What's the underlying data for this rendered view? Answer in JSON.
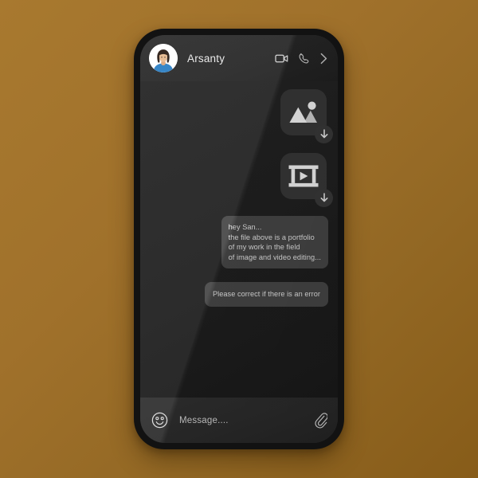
{
  "background": {
    "color_top_left": "#a8792f",
    "color_bottom_right": "#875c19"
  },
  "device": {
    "frame_color": "#121212",
    "screen_color": "#232323"
  },
  "header": {
    "contact_name": "Arsanty",
    "avatar": {
      "icon": "person-avatar",
      "hair_color": "#2b1d15",
      "skin_color": "#e7b98e",
      "shirt_color": "#2c7fc4",
      "background_color": "#ffffff"
    },
    "actions": [
      {
        "name": "video-call",
        "icon": "video-camera-icon"
      },
      {
        "name": "voice-call",
        "icon": "phone-handset-icon"
      },
      {
        "name": "more",
        "icon": "chevron-right-icon"
      }
    ]
  },
  "chat": {
    "attachments": [
      {
        "type": "image",
        "icon": "image-placeholder-icon",
        "download_icon": "download-arrow-icon",
        "tile_color": "#3a3a3a"
      },
      {
        "type": "video",
        "icon": "video-placeholder-icon",
        "download_icon": "download-arrow-icon",
        "tile_color": "#3a3a3a"
      }
    ],
    "messages": [
      {
        "id": "m1",
        "text": "hey San...\nthe file above is a portfolio\nof my work in the field\nof image and video editing...",
        "bubble_color": "#4a4a4a"
      },
      {
        "id": "m2",
        "text": "Please correct if there is an error",
        "bubble_color": "#4a4a4a"
      }
    ]
  },
  "input_bar": {
    "emoji_icon": "smiley-face-icon",
    "placeholder": "Message....",
    "attach_icon": "paperclip-icon",
    "background_color": "#303030"
  }
}
